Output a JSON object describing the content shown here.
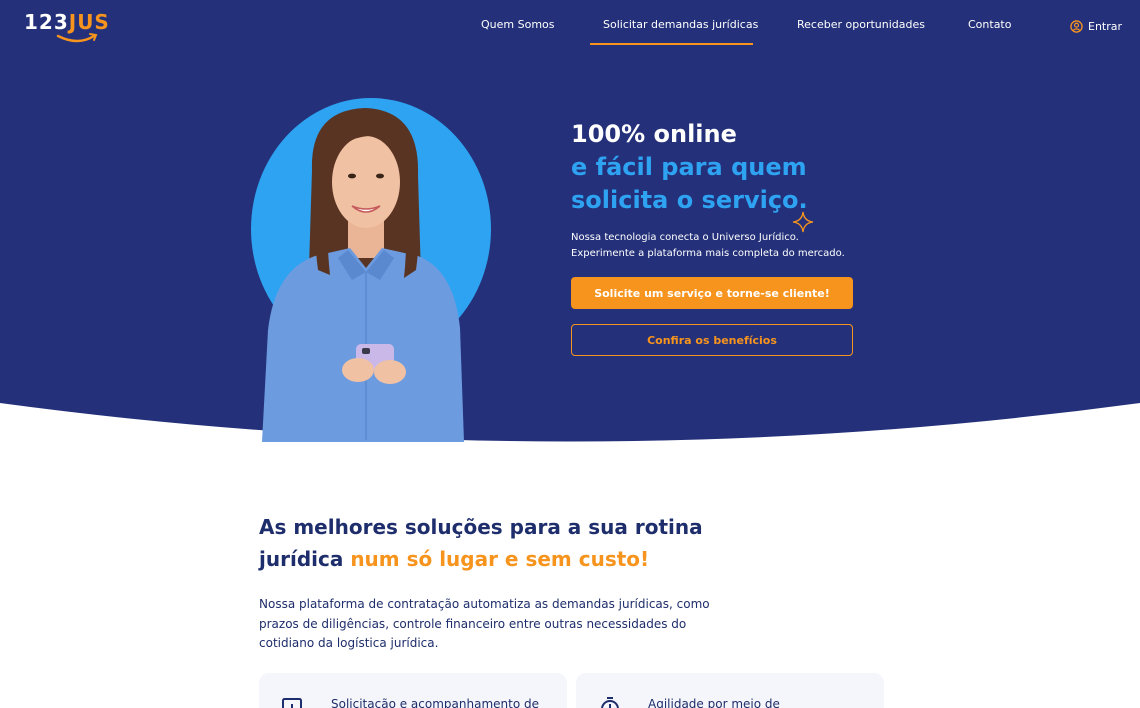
{
  "brand": {
    "logo_main": "123",
    "logo_accent": "JUS",
    "primary_color": "#24317a",
    "accent_color": "#f7941d",
    "highlight_color": "#2ea3f2"
  },
  "nav": {
    "items": [
      "Quem Somos",
      "Solicitar demandas jurídicas",
      "Receber oportunidades",
      "Contato"
    ],
    "active_index": 1,
    "login_label": "Entrar"
  },
  "hero": {
    "headline_line1": "100% online",
    "headline_line2": "e fácil para quem",
    "headline_line3": "solicita o serviço.",
    "subtext_line1": "Nossa tecnologia conecta o Universo Jurídico.",
    "subtext_line2": "Experimente a plataforma mais completa do mercado.",
    "primary_button": "Solicite um serviço e torne-se cliente!",
    "secondary_button": "Confira os benefícios"
  },
  "solutions": {
    "title_part1": "As melhores soluções para a sua rotina",
    "title_part2": "jurídica",
    "title_highlight": "num só lugar e sem custo!",
    "description": "Nossa plataforma de contratação automatiza as demandas jurídicas, como prazos de diligências, controle financeiro entre outras necessidades do cotidiano da logística jurídica."
  },
  "cards": [
    {
      "icon": "document-icon",
      "text": "Solicitação e acompanhamento de"
    },
    {
      "icon": "stopwatch-icon",
      "text": "Agilidade por meio de"
    }
  ]
}
